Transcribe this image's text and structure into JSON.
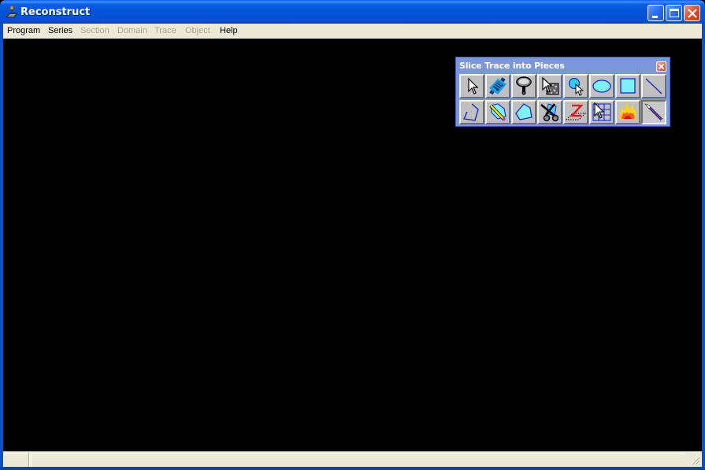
{
  "window": {
    "title": "Reconstruct",
    "controls": [
      "minimize",
      "maximize",
      "close"
    ]
  },
  "menubar": {
    "items": [
      {
        "label": "Program",
        "enabled": true
      },
      {
        "label": "Series",
        "enabled": true
      },
      {
        "label": "Section",
        "enabled": false
      },
      {
        "label": "Domain",
        "enabled": false
      },
      {
        "label": "Trace",
        "enabled": false
      },
      {
        "label": "Object",
        "enabled": false
      },
      {
        "label": "Help",
        "enabled": true
      }
    ]
  },
  "palette": {
    "title": "Slice Trace into Pieces",
    "tools": [
      {
        "name": "pointer",
        "icon": "arrow-pointer-icon"
      },
      {
        "name": "pan-zoom",
        "icon": "pan-zoom-icon"
      },
      {
        "name": "magnify",
        "icon": "magnifier-icon"
      },
      {
        "name": "domain-select",
        "icon": "domain-pointer-icon"
      },
      {
        "name": "circle-select",
        "icon": "circle-pointer-icon"
      },
      {
        "name": "ellipse",
        "icon": "ellipse-icon"
      },
      {
        "name": "rectangle",
        "icon": "rectangle-icon"
      },
      {
        "name": "line",
        "icon": "line-icon"
      },
      {
        "name": "open-polyline",
        "icon": "polyline-icon"
      },
      {
        "name": "pencil",
        "icon": "pencil-icon"
      },
      {
        "name": "closed-polygon",
        "icon": "polygon-icon"
      },
      {
        "name": "scissors",
        "icon": "scissors-icon"
      },
      {
        "name": "z-trace",
        "icon": "z-trace-icon"
      },
      {
        "name": "grid",
        "icon": "grid-pointer-icon"
      },
      {
        "name": "wildfire",
        "icon": "fire-icon"
      },
      {
        "name": "scalpel",
        "icon": "scalpel-icon",
        "active": true
      }
    ]
  },
  "statusbar": {
    "panes": [
      "",
      ""
    ]
  }
}
